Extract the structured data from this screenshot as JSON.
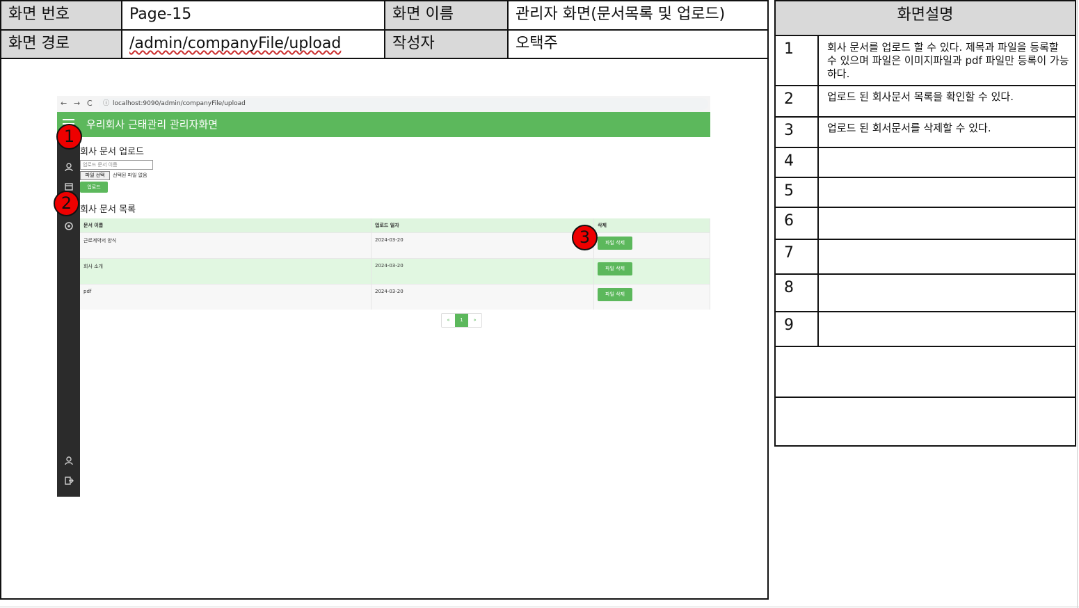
{
  "header": {
    "screen_no_label": "화면 번호",
    "screen_no": "Page-15",
    "screen_name_label": "화면 이름",
    "screen_name": "관리자 화면(문서목록 및 업로드)",
    "path_label": "화면 경로",
    "path": "/admin/companyFile/upload",
    "author_label": "작성자",
    "author": "오택주"
  },
  "browser": {
    "back": "←",
    "forward": "→",
    "reload": "C",
    "url": "localhost:9090/admin/companyFile/upload"
  },
  "app": {
    "title": "우리회사 근태관리 관리자화면",
    "upload_section_title": "회사 문서 업로드",
    "title_input_placeholder": "업로드 문서 이름",
    "file_button": "파일 선택",
    "file_status": "선택된 파일 없음",
    "upload_button": "업로드",
    "list_section_title": "회사 문서 목록",
    "columns": [
      "문서 이름",
      "업로드 일자",
      "삭제"
    ],
    "rows": [
      {
        "name": "근로계약서 양식",
        "date": "2024-03-20",
        "action": "파일 삭제"
      },
      {
        "name": "회사 소개",
        "date": "2024-03-20",
        "action": "파일 삭제"
      },
      {
        "name": "pdf",
        "date": "2024-03-20",
        "action": "파일 삭제"
      }
    ],
    "pagination": {
      "prev": "«",
      "current": "1",
      "next": "»"
    },
    "sidebar_icons": [
      "user-icon",
      "calendar-icon",
      "settings-icon",
      "profile-icon",
      "logout-icon"
    ]
  },
  "markers": [
    "1",
    "2",
    "3"
  ],
  "description": {
    "title": "화면설명",
    "rows": [
      {
        "no": "1",
        "text": " 회사 문서를 업로드 할 수 있다. 제목과 파일을 등록할 수 있으며 파일은 이미지파일과 pdf 파일만 등록이 가능하다."
      },
      {
        "no": "2",
        "text": "업로드 된 회사문서 목록을 확인할 수 있다."
      },
      {
        "no": "3",
        "text": "업로드 된 회서문서를 삭제할 수 있다."
      },
      {
        "no": "4",
        "text": ""
      },
      {
        "no": "5",
        "text": ""
      },
      {
        "no": "6",
        "text": ""
      },
      {
        "no": "7",
        "text": ""
      },
      {
        "no": "8",
        "text": ""
      },
      {
        "no": "9",
        "text": ""
      },
      {
        "no": "",
        "text": ""
      },
      {
        "no": "",
        "text": ""
      }
    ]
  },
  "colors": {
    "accent": "#5cb85c",
    "label_bg": "#d9d9d9",
    "marker": "#ee0000",
    "sidebar": "#2b2b2b"
  }
}
